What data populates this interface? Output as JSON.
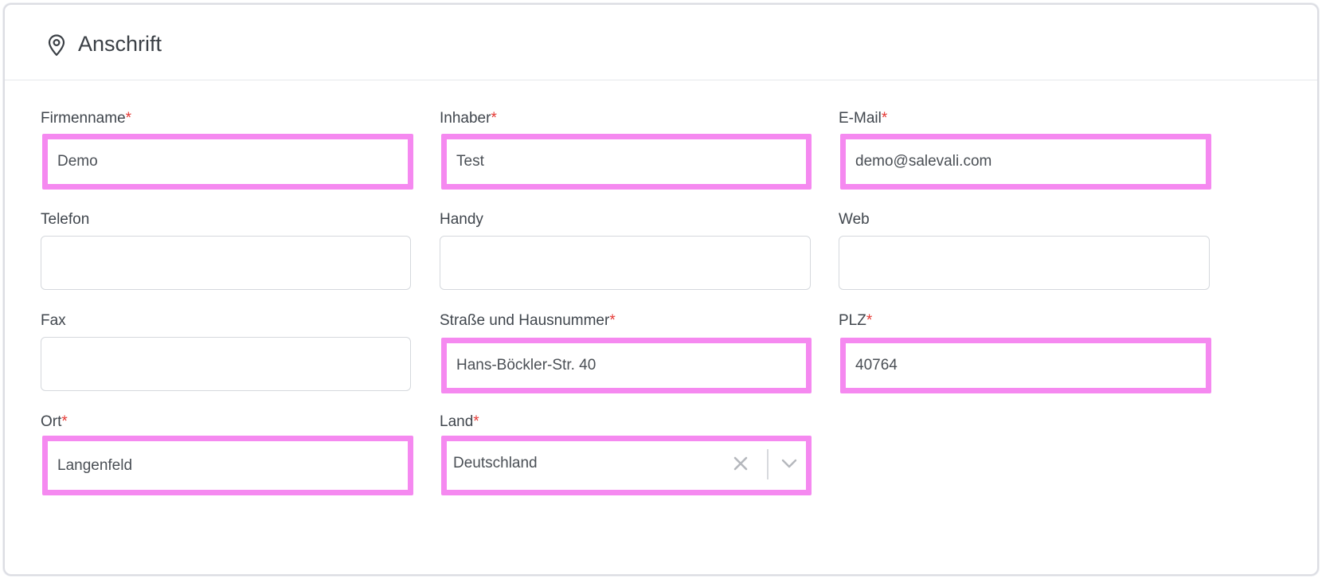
{
  "section": {
    "title": "Anschrift",
    "icon": "map-pin-icon"
  },
  "colors": {
    "highlight": "#f589f0",
    "required": "#e53935",
    "border": "#d5d8dd"
  },
  "fields": {
    "firmenname": {
      "label": "Firmenname",
      "required_mark": "*",
      "value": "Demo"
    },
    "inhaber": {
      "label": "Inhaber",
      "required_mark": "*",
      "value": "Test"
    },
    "email": {
      "label": "E-Mail",
      "required_mark": "*",
      "value": "demo@salevali.com"
    },
    "telefon": {
      "label": "Telefon",
      "value": ""
    },
    "handy": {
      "label": "Handy",
      "value": ""
    },
    "web": {
      "label": "Web",
      "value": ""
    },
    "fax": {
      "label": "Fax",
      "value": ""
    },
    "strasse": {
      "label": "Straße und Hausnummer",
      "required_mark": "*",
      "value": "Hans-Böckler-Str. 40"
    },
    "plz": {
      "label": "PLZ",
      "required_mark": "*",
      "value": "40764"
    },
    "ort": {
      "label": "Ort",
      "required_mark": "*",
      "value": "Langenfeld"
    },
    "land": {
      "label": "Land",
      "required_mark": "*",
      "value": "Deutschland",
      "clear_icon": "close-icon",
      "dropdown_icon": "chevron-down-icon"
    }
  }
}
